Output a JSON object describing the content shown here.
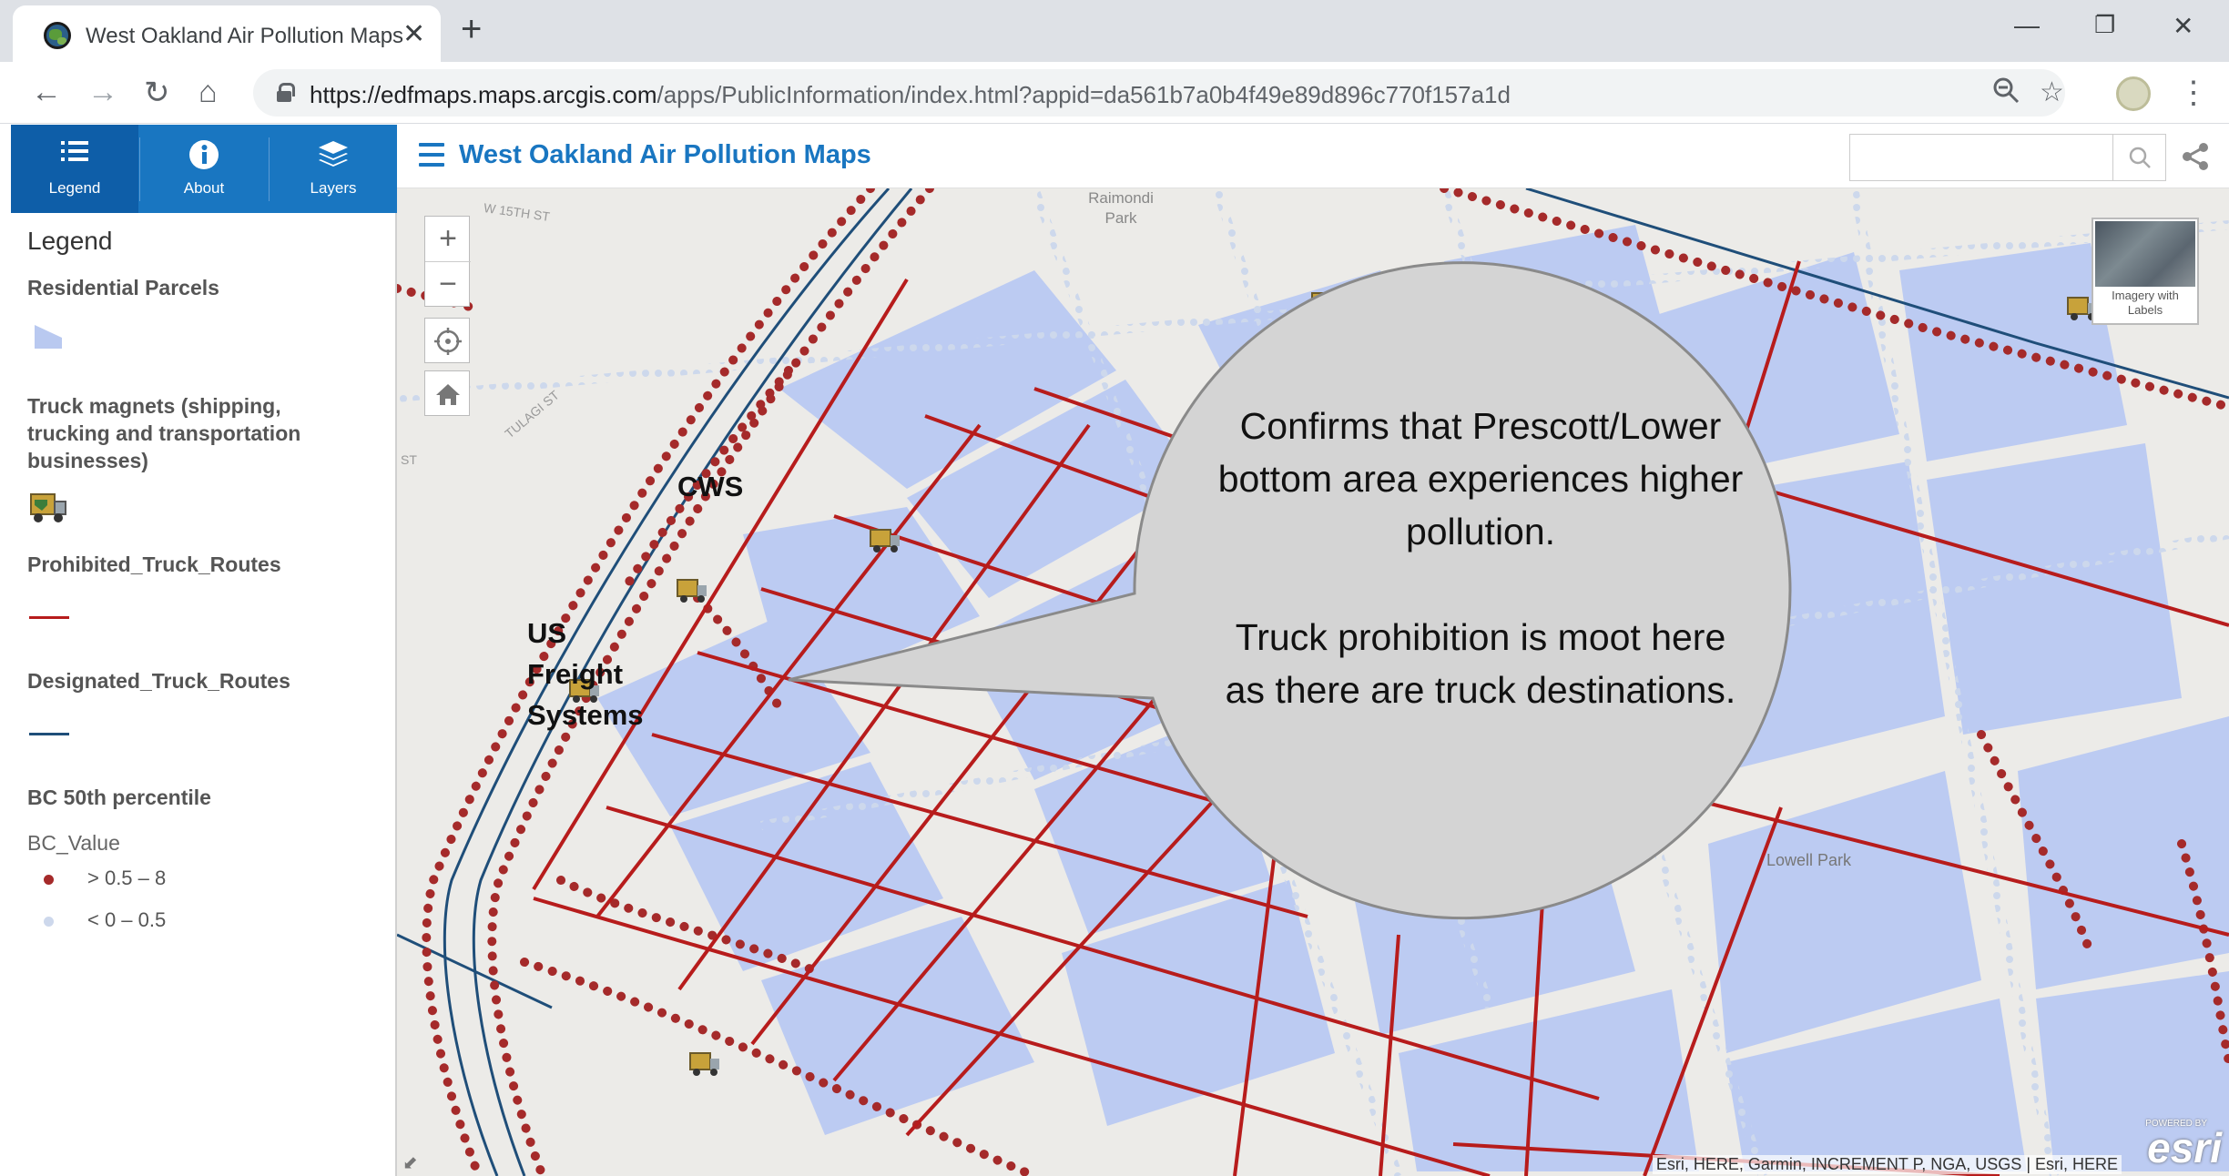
{
  "browser": {
    "tab_title": "West Oakland Air Pollution Maps",
    "url_host": "https://edfmaps.maps.arcgis.com",
    "url_path": "/apps/PublicInformation/index.html?appid=da561b7a0b4f49e89d896c770f157a1d"
  },
  "app": {
    "title": "West Oakland Air Pollution Maps",
    "panel_tabs": [
      {
        "label": "Legend",
        "icon": "list-icon",
        "active": true
      },
      {
        "label": "About",
        "icon": "info-icon",
        "active": false
      },
      {
        "label": "Layers",
        "icon": "layers-icon",
        "active": false
      }
    ]
  },
  "legend": {
    "title": "Legend",
    "layers": {
      "residential": "Residential Parcels",
      "truck_magnets": "Truck magnets (shipping, trucking and transportation businesses)",
      "prohibited": "Prohibited_Truck_Routes",
      "designated": "Designated_Truck_Routes",
      "bc": "BC 50th percentile"
    },
    "bc_field": "BC_Value",
    "bc_classes": [
      {
        "label": "> 0.5 – 8",
        "color": "#a52a2a"
      },
      {
        "label": "< 0 – 0.5",
        "color": "#cdd8ec"
      }
    ],
    "colors": {
      "parcel": "#b9c9f0",
      "prohibited": "#b71c1c",
      "designated": "#1f4e79"
    }
  },
  "map": {
    "basemap_label": "Imagery with Labels",
    "attribution": "Esri, HERE, Garmin, INCREMENT P, NGA, USGS | Esri, HERE",
    "esri_logo": "esri",
    "powered_by": "POWERED BY",
    "labels": {
      "cws": "CWS",
      "us_freight": "US Freight Systems",
      "raimondi": "Raimondi Park",
      "lowell": "Lowell Park",
      "street1": "W 15TH ST",
      "street2": "TULAGI ST",
      "street3": "ST"
    },
    "callout": {
      "line1": "Confirms that Prescott/Lower bottom area experiences higher pollution.",
      "line2": "Truck prohibition is moot here as there are truck destinations."
    }
  }
}
